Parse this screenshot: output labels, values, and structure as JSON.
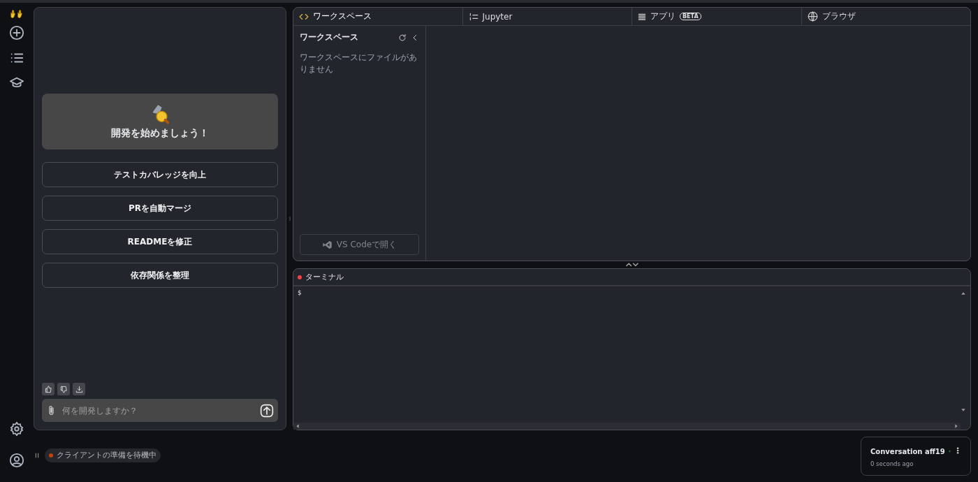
{
  "rail": {
    "items": [
      {
        "kind": "new"
      },
      {
        "kind": "list"
      },
      {
        "kind": "learn"
      }
    ],
    "bottom": [
      {
        "kind": "settings"
      },
      {
        "kind": "account"
      }
    ]
  },
  "chat": {
    "welcome": "開発を始めましょう！",
    "suggestions": [
      "テストカバレッジを向上",
      "PRを自動マージ",
      "READMEを修正",
      "依存関係を整理"
    ],
    "input": {
      "placeholder": "何を開発しますか？"
    }
  },
  "tabs": [
    {
      "label": "ワークスペース",
      "kind": "code",
      "selected": true
    },
    {
      "label": "Jupyter",
      "kind": "jupyter",
      "selected": false
    },
    {
      "label": "アプリ",
      "kind": "app",
      "badge": "BETA",
      "selected": false
    },
    {
      "label": "ブラウザ",
      "kind": "browser",
      "selected": false
    }
  ],
  "workspace": {
    "title": "ワークスペース",
    "empty": "ワークスペースにファイルがありません",
    "open_button": "VS Codeで開く"
  },
  "terminal": {
    "title": "ターミナル",
    "prompt": "$"
  },
  "status": {
    "text": "クライアントの準備を待機中",
    "color": "#c2410c"
  },
  "conversation": {
    "title": "Conversation aff19",
    "time": "0 seconds ago"
  }
}
